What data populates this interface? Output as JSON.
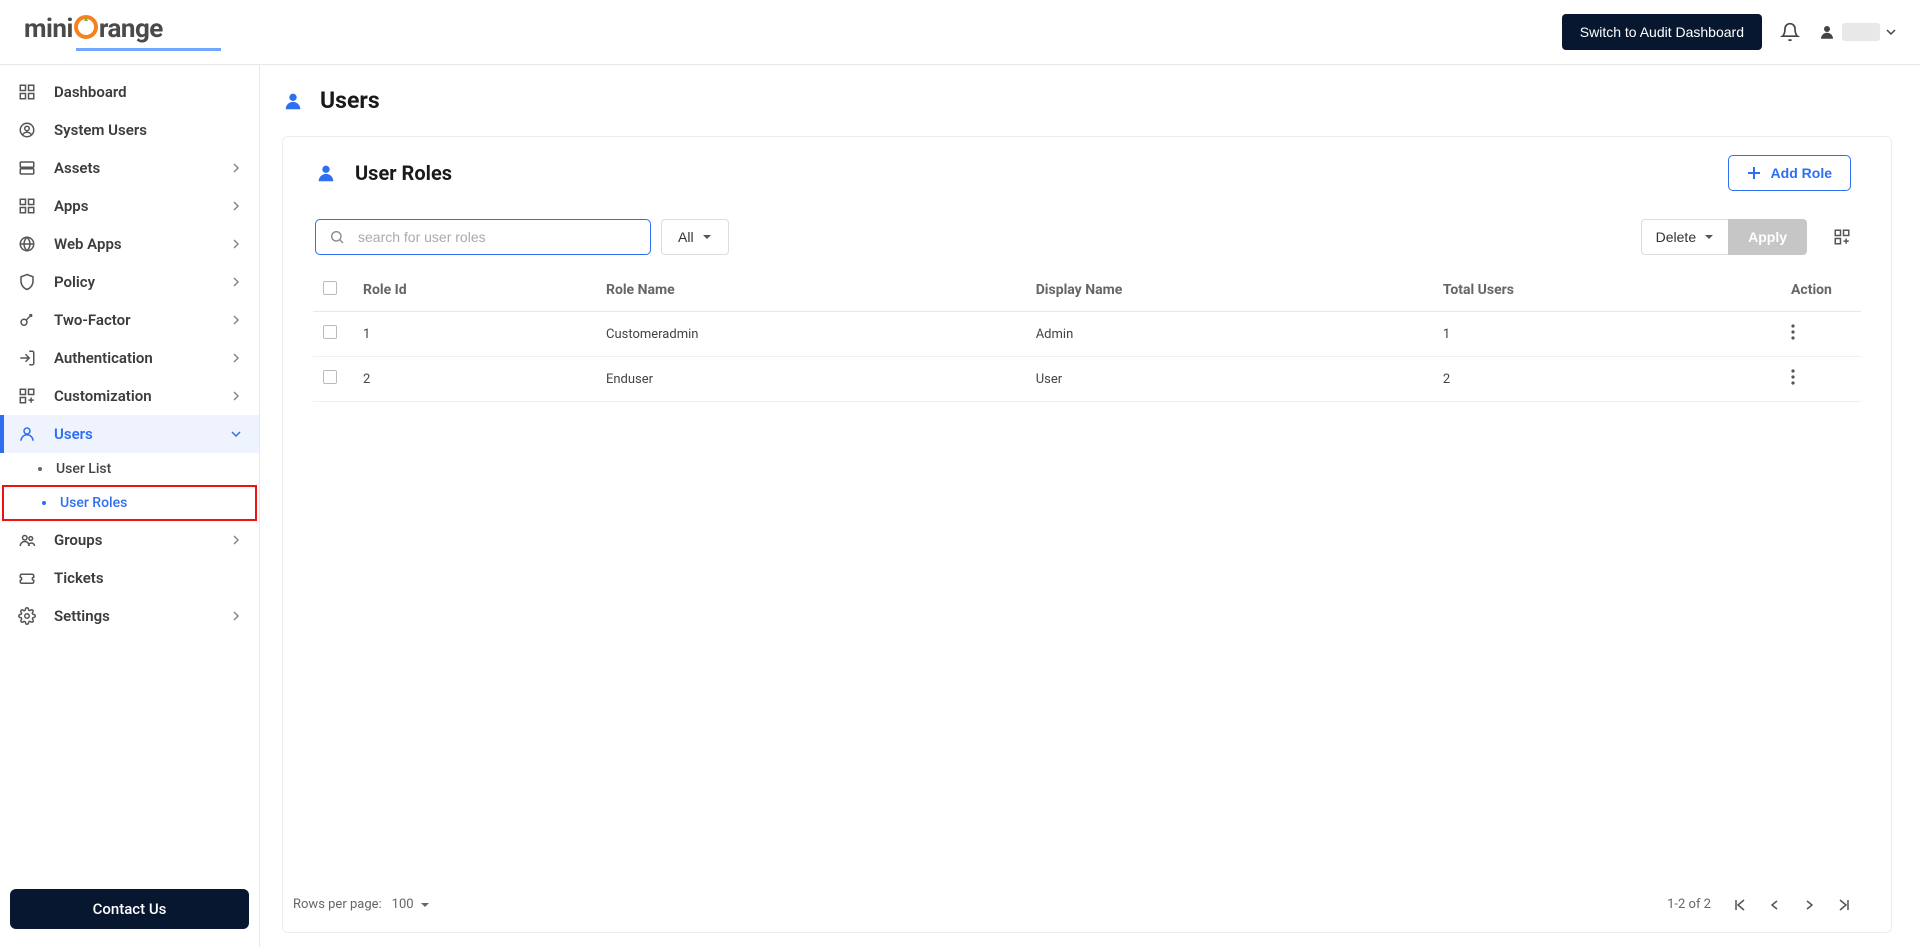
{
  "brand": {
    "prefix": "mini",
    "orange_letter": "O",
    "suffix": "range"
  },
  "topbar": {
    "switch_label": "Switch to Audit Dashboard"
  },
  "sidebar": {
    "items": [
      {
        "label": "Dashboard",
        "expandable": false
      },
      {
        "label": "System Users",
        "expandable": false
      },
      {
        "label": "Assets",
        "expandable": true
      },
      {
        "label": "Apps",
        "expandable": true
      },
      {
        "label": "Web Apps",
        "expandable": true
      },
      {
        "label": "Policy",
        "expandable": true
      },
      {
        "label": "Two-Factor",
        "expandable": true
      },
      {
        "label": "Authentication",
        "expandable": true
      },
      {
        "label": "Customization",
        "expandable": true
      },
      {
        "label": "Users",
        "expandable": true,
        "active": true
      },
      {
        "label": "Groups",
        "expandable": true
      },
      {
        "label": "Tickets",
        "expandable": false
      },
      {
        "label": "Settings",
        "expandable": true
      }
    ],
    "users_sub": [
      {
        "label": "User List"
      },
      {
        "label": "User Roles",
        "active": true,
        "highlighted": true
      }
    ],
    "contact_label": "Contact Us"
  },
  "page": {
    "title": "Users",
    "section_title": "User Roles",
    "add_role_label": "Add Role",
    "search_placeholder": "search for user roles",
    "filter_label": "All",
    "delete_label": "Delete",
    "apply_label": "Apply"
  },
  "table": {
    "headers": {
      "role_id": "Role Id",
      "role_name": "Role Name",
      "display_name": "Display Name",
      "total_users": "Total Users",
      "action": "Action"
    },
    "rows": [
      {
        "id": "1",
        "role_name": "Customeradmin",
        "display_name": "Admin",
        "total_users": "1"
      },
      {
        "id": "2",
        "role_name": "Enduser",
        "display_name": "User",
        "total_users": "2"
      }
    ]
  },
  "pagination": {
    "rows_label": "Rows per page:",
    "rows_value": "100",
    "range_text": "1-2 of 2"
  }
}
